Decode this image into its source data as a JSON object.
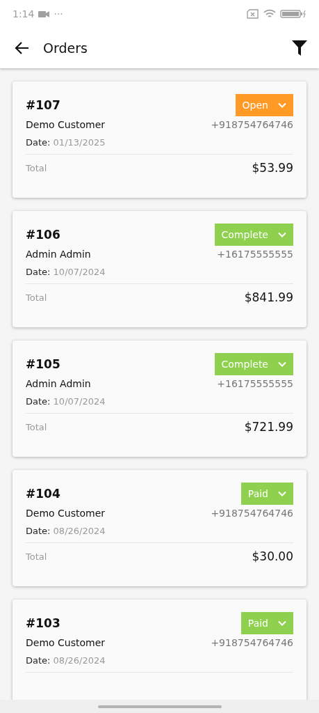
{
  "status_bar": {
    "time": "1:14",
    "notification_dots": "···"
  },
  "app_bar": {
    "title": "Orders"
  },
  "orders": [
    {
      "number": "#107",
      "status": "Open",
      "color": "#ff9a27",
      "customer": "Demo Customer",
      "phone": "+918754764746",
      "date_label": "Date:",
      "date": "01/13/2025",
      "total_label": "Total",
      "total": "$53.99"
    },
    {
      "number": "#106",
      "status": "Complete",
      "color": "#8fd14f",
      "customer": "Admin Admin",
      "phone": "+16175555555",
      "date_label": "Date:",
      "date": "10/07/2024",
      "total_label": "Total",
      "total": "$841.99"
    },
    {
      "number": "#105",
      "status": "Complete",
      "color": "#8fd14f",
      "customer": "Admin Admin",
      "phone": "+16175555555",
      "date_label": "Date:",
      "date": "10/07/2024",
      "total_label": "Total",
      "total": "$721.99"
    },
    {
      "number": "#104",
      "status": "Paid",
      "color": "#8fd14f",
      "customer": "Demo Customer",
      "phone": "+918754764746",
      "date_label": "Date:",
      "date": "08/26/2024",
      "total_label": "Total",
      "total": "$30.00"
    },
    {
      "number": "#103",
      "status": "Paid",
      "color": "#8fd14f",
      "customer": "Demo Customer",
      "phone": "+918754764746",
      "date_label": "Date:",
      "date": "08/26/2024"
    }
  ]
}
